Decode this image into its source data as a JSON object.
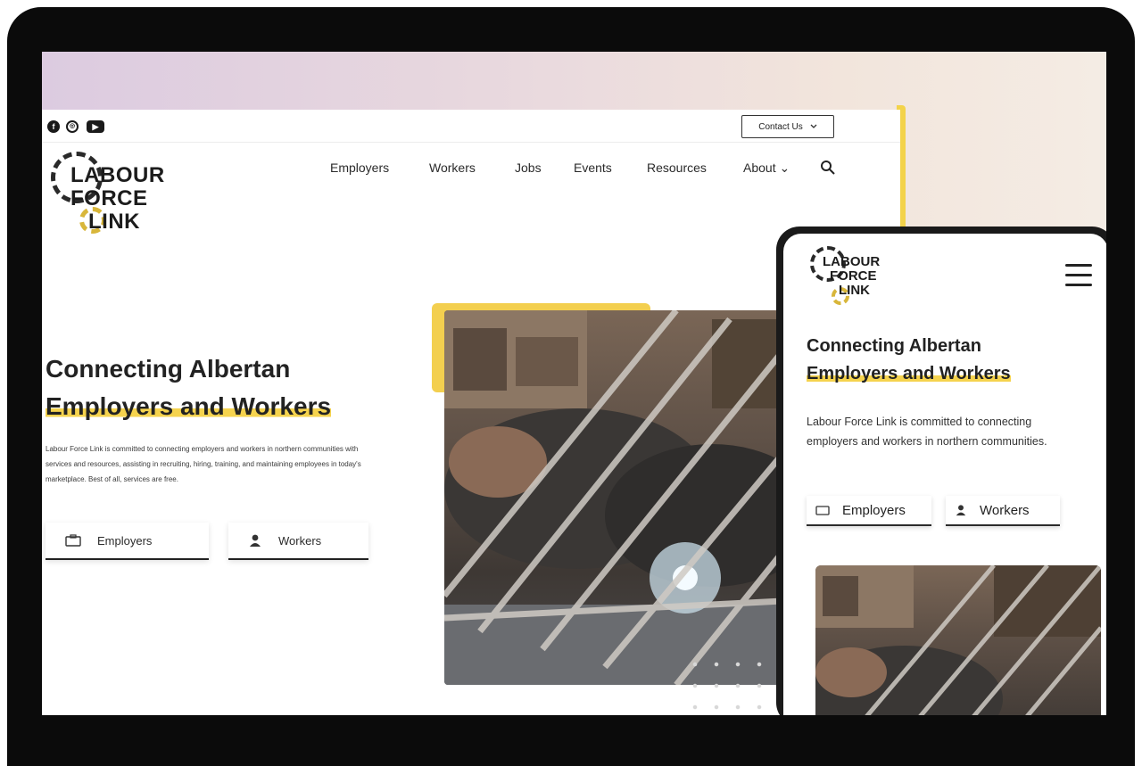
{
  "desktop": {
    "contact_button": {
      "label": "Contact Us",
      "icon": "chevron-down-icon"
    },
    "social_icons": [
      "facebook-icon",
      "instagram-icon",
      "youtube-icon"
    ],
    "logo": {
      "line1": "LABOUR",
      "line2": "FORCE",
      "line3": "LINK"
    },
    "nav": [
      {
        "label": "Employers"
      },
      {
        "label": "Workers"
      },
      {
        "label": "Jobs"
      },
      {
        "label": "Events"
      },
      {
        "label": "Resources"
      },
      {
        "label": "About ⌄"
      }
    ],
    "hero": {
      "title_line1": "Connecting Albertan",
      "title_line2": "Employers and Workers",
      "body": "Labour Force Link is committed to connecting employers and workers in northern communities with services and resources, assisting in recruiting, hiring, training, and maintaining employees in today's marketplace. Best of all, services are free.",
      "cta_employers": "Employers",
      "cta_workers": "Workers"
    }
  },
  "mobile": {
    "logo": {
      "line1": "LABOUR",
      "line2": "FORCE",
      "line3": "LINK"
    },
    "hero": {
      "title_line1": "Connecting Albertan",
      "title_line2": "Employers and Workers",
      "body": "Labour Force Link is committed to connecting employers and workers in northern communities.",
      "cta_employers": "Employers",
      "cta_workers": "Workers"
    }
  },
  "colors": {
    "accent": "#f5d34e",
    "text": "#222222",
    "bezel": "#0b0b0b"
  }
}
